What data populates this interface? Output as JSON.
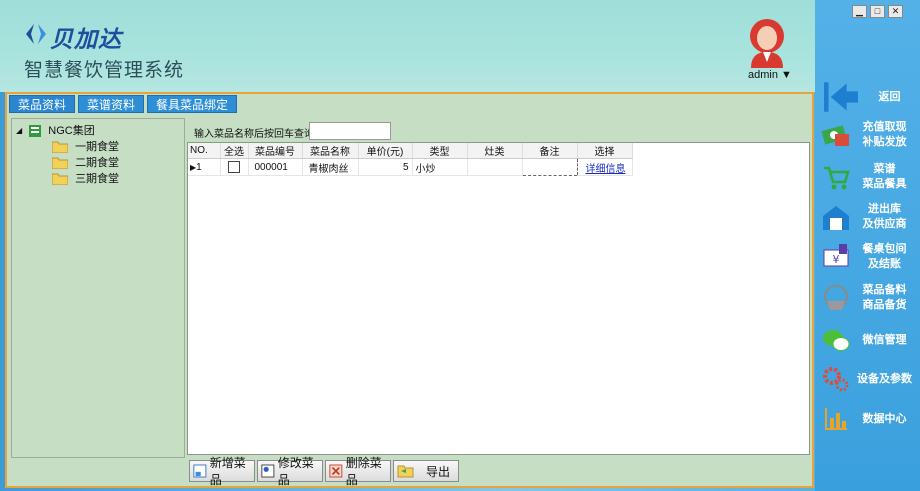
{
  "app": {
    "brand": "贝加达",
    "subtitle": "智慧餐饮管理系统",
    "user": "admin ▼"
  },
  "window_controls": [
    "▁",
    "□",
    "✕"
  ],
  "tabs": [
    "菜品资料",
    "菜谱资料",
    "餐具菜品绑定"
  ],
  "tree": {
    "root": "NGC集团",
    "children": [
      "一期食堂",
      "二期食堂",
      "三期食堂"
    ]
  },
  "search": {
    "label": "输入菜品名称后按回车查询",
    "value": ""
  },
  "table": {
    "headers": [
      "NO.",
      "全选",
      "菜品编号",
      "菜品名称",
      "单价(元)",
      "类型",
      "灶类",
      "备注",
      "选择"
    ],
    "rows": [
      {
        "no": "1",
        "code": "000001",
        "name": "青椒肉丝",
        "price": "5",
        "type": "小炒",
        "stove": "",
        "note": "",
        "action": "详细信息"
      }
    ]
  },
  "buttons": {
    "add": "新增菜品",
    "edit": "修改菜品",
    "delete": "删除菜品",
    "export": "导出"
  },
  "sidebar": [
    {
      "label": "返回",
      "icon": "back-arrow-icon"
    },
    {
      "label": "充值取现\n补贴发放",
      "icon": "money-icon"
    },
    {
      "label": "菜谱\n菜品餐具",
      "icon": "cart-icon"
    },
    {
      "label": "进出库\n及供应商",
      "icon": "warehouse-icon"
    },
    {
      "label": "餐桌包间\n及结账",
      "icon": "yen-bill-icon"
    },
    {
      "label": "菜品备料\n商品备货",
      "icon": "basket-icon"
    },
    {
      "label": "微信管理",
      "icon": "wechat-icon"
    },
    {
      "label": "设备及参数",
      "icon": "gear-icon"
    },
    {
      "label": "数据中心",
      "icon": "bar-chart-icon"
    }
  ],
  "colors": {
    "accent": "#2f8fd6",
    "panel": "#c5dec4",
    "border_highlight": "#e8a438",
    "link": "#1a2cc2"
  }
}
